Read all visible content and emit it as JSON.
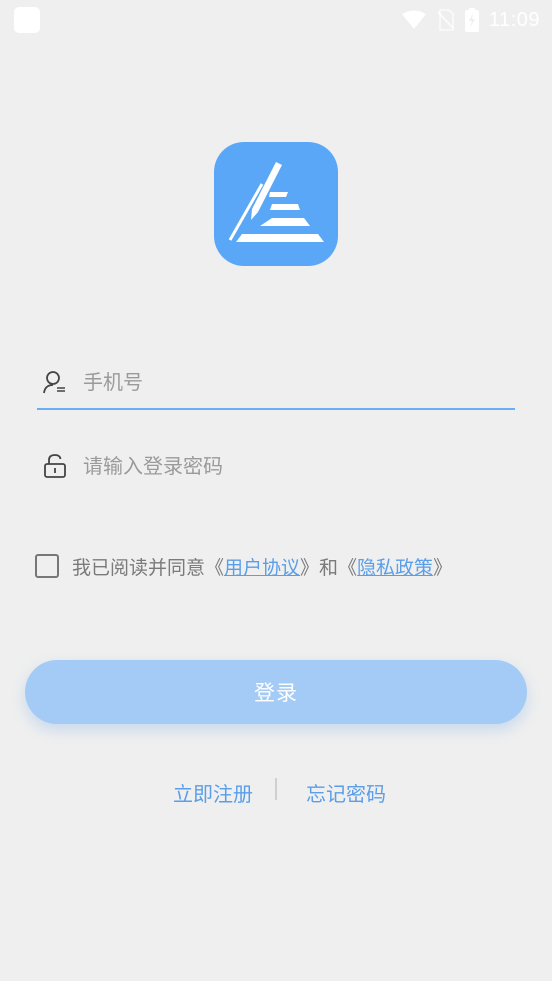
{
  "status_bar": {
    "time": "11:09",
    "icons": [
      "notification-square-icon",
      "wifi-icon",
      "no-sim-icon",
      "battery-charging-icon"
    ]
  },
  "app": {
    "logo_icon": "pen-triangle-logo-icon",
    "brand_color": "#5aa7f7"
  },
  "login_form": {
    "phone_placeholder": "手机号",
    "phone_value": "",
    "password_placeholder": "请输入登录密码",
    "password_value": "",
    "agreement": {
      "checked": false,
      "prefix": "我已阅读并同意《",
      "user_agreement": "用户协议",
      "middle": "》和《",
      "privacy_policy": "隐私政策",
      "suffix": "》"
    },
    "login_label": "登录"
  },
  "links": {
    "register": "立即注册",
    "forgot_password": "忘记密码"
  },
  "colors": {
    "background": "#efefef",
    "accent": "#5a9ee8",
    "button_disabled": "#a3cbf6",
    "input_underline": "#6aaef5"
  }
}
